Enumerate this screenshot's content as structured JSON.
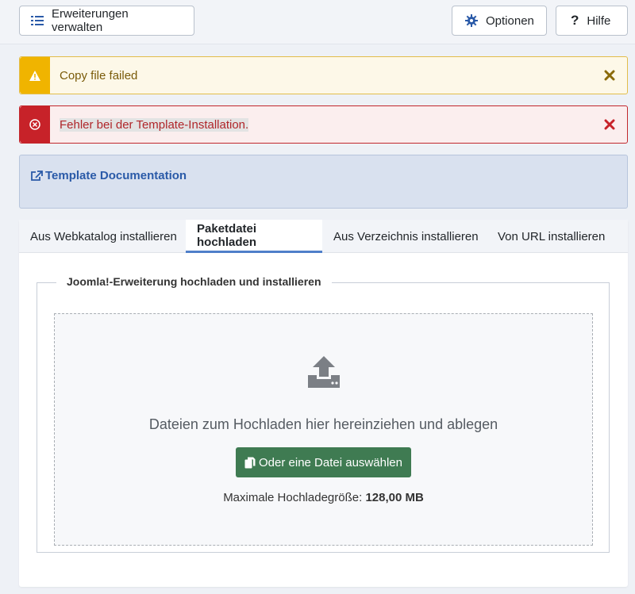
{
  "toolbar": {
    "manage_label": "Erweiterungen verwalten",
    "options_label": "Optionen",
    "help_label": "Hilfe"
  },
  "alerts": {
    "warning": "Copy file failed",
    "error": "Fehler bei der Template-Installation."
  },
  "doc": {
    "link_label": "Template Documentation"
  },
  "tabs": [
    {
      "label": "Aus Webkatalog installieren",
      "active": false
    },
    {
      "label": "Paketdatei hochladen",
      "active": true
    },
    {
      "label": "Aus Verzeichnis installieren",
      "active": false
    },
    {
      "label": "Von URL installieren",
      "active": false
    }
  ],
  "upload": {
    "legend": "Joomla!-Erweiterung hochladen und installieren",
    "drop_text": "Dateien zum Hochladen hier hereinziehen und ablegen",
    "choose_label": "Oder eine Datei auswählen",
    "max_size_label": "Maximale Hochladegröße:",
    "max_size_value": "128,00 MB"
  },
  "colors": {
    "warning": "#f0b400",
    "error": "#c72229",
    "primary_link": "#2a5aa8",
    "success_button": "#3f7b52",
    "active_tab": "#4f7fc9"
  }
}
